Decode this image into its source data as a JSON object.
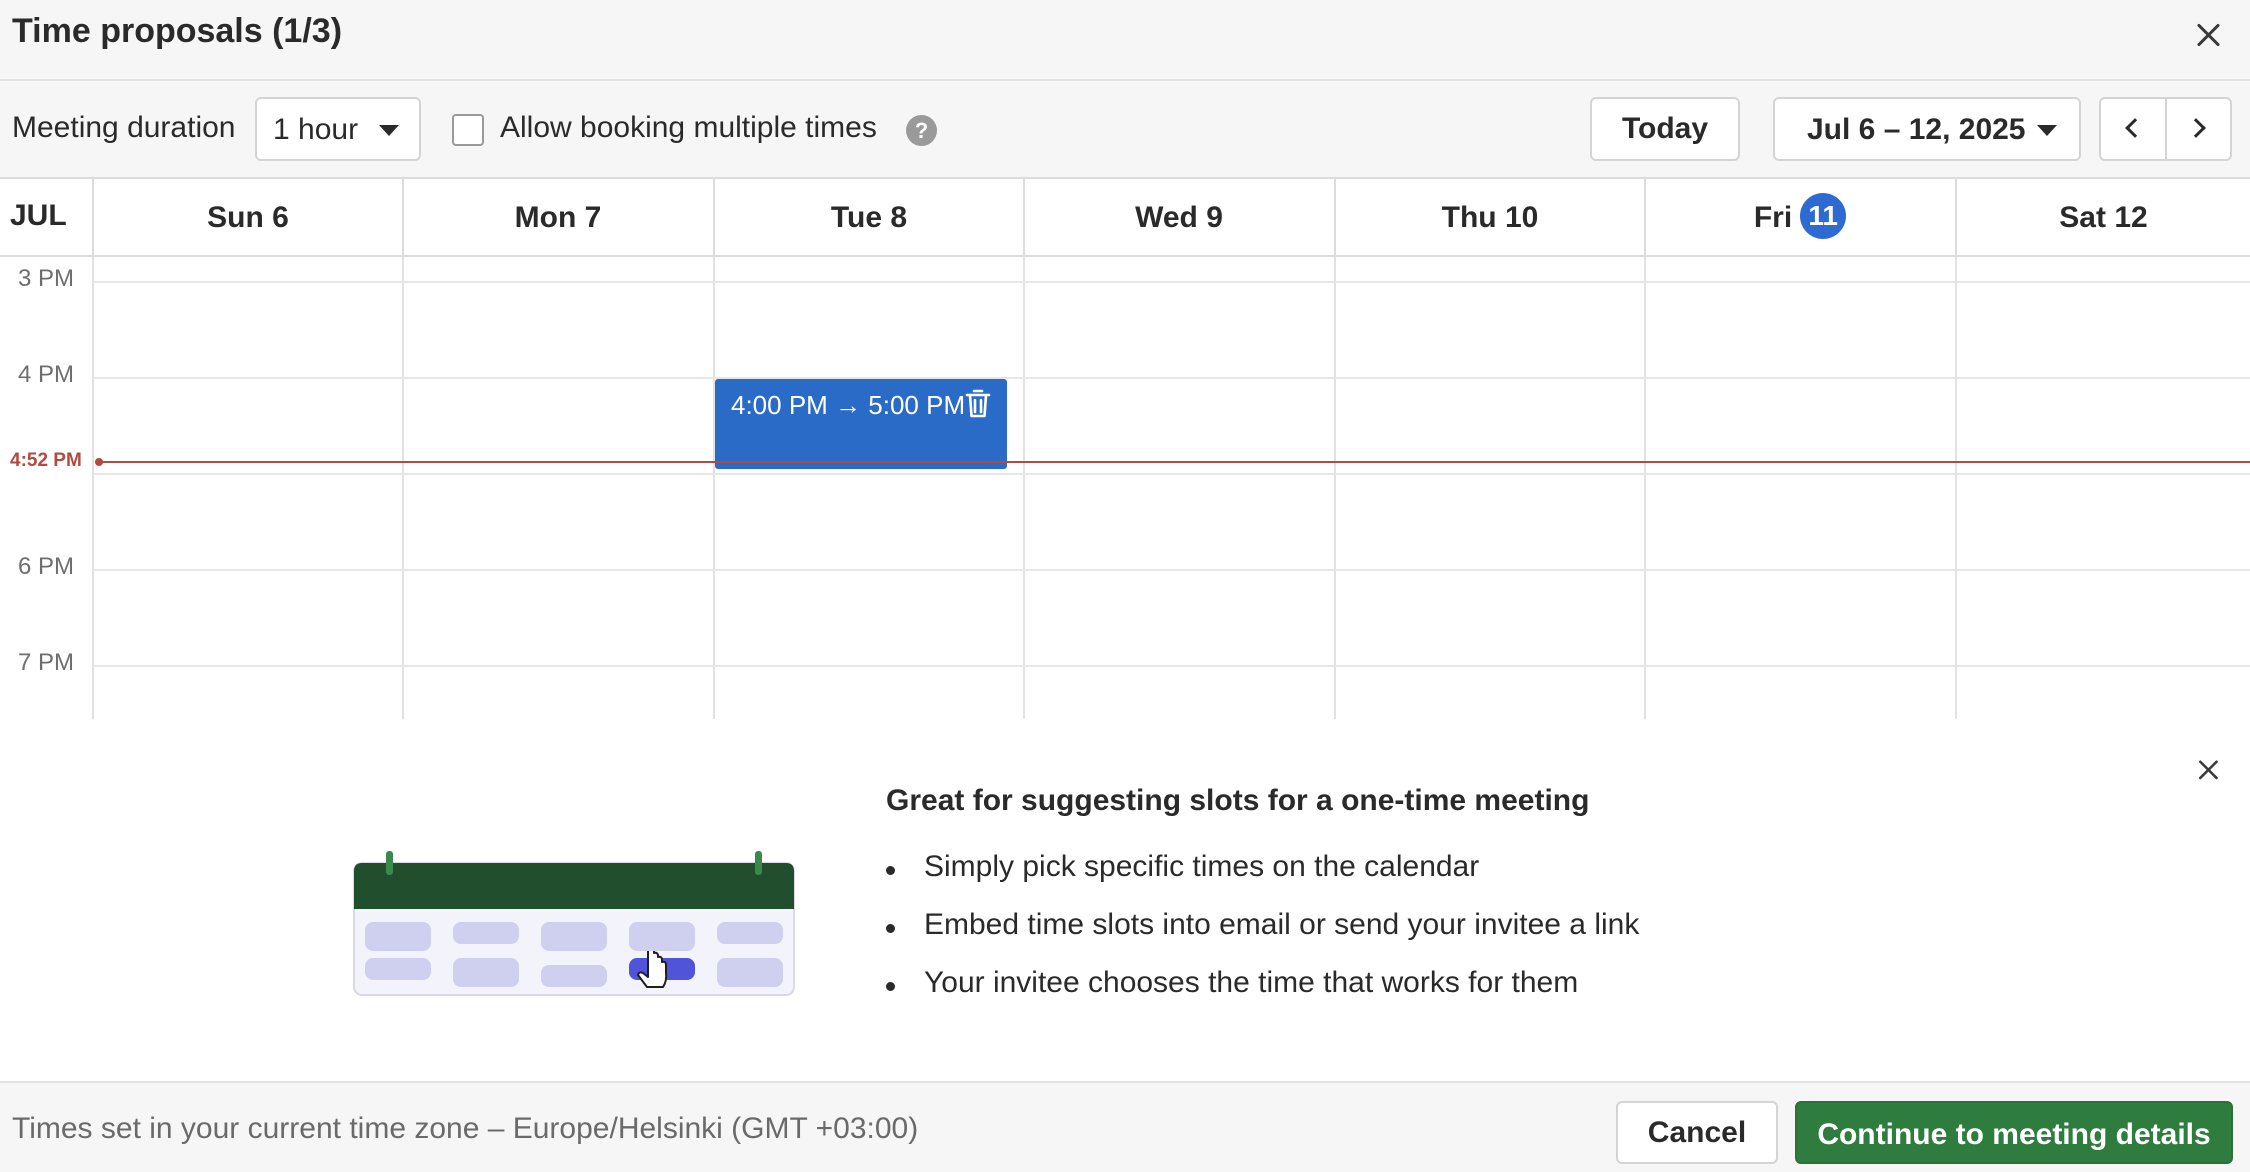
{
  "dialog": {
    "title": "Time proposals (1/3)"
  },
  "toolbar": {
    "duration_label": "Meeting duration",
    "duration_value": "1 hour",
    "multiple_label": "Allow booking multiple times",
    "multiple_checked": false,
    "help_glyph": "?",
    "today_label": "Today",
    "date_range": "Jul 6 – 12, 2025"
  },
  "calendar": {
    "month": "JUL",
    "days": [
      {
        "label": "Sun 6"
      },
      {
        "label": "Mon 7"
      },
      {
        "label": "Tue 8"
      },
      {
        "label": "Wed 9"
      },
      {
        "label": "Thu 10"
      },
      {
        "label": "Fri",
        "badge": "11"
      },
      {
        "label": "Sat 12"
      }
    ],
    "hours": [
      "3 PM",
      "4 PM",
      "6 PM",
      "7 PM"
    ],
    "current_time": "4:52 PM",
    "event": {
      "label": "4:00 PM → 5:00 PM",
      "day": "Tue 8",
      "color": "#2b6bc8"
    }
  },
  "info": {
    "title": "Great for suggesting slots for a one-time meeting",
    "bullets": [
      "Simply pick specific times on the calendar",
      "Embed time slots into email or send your invitee a link",
      "Your invitee chooses the time that works for them"
    ]
  },
  "footer": {
    "timezone": "Times set in your current time zone – Europe/Helsinki (GMT +03:00)",
    "cancel_label": "Cancel",
    "continue_label": "Continue to meeting details"
  },
  "colors": {
    "accent": "#2d6ad1",
    "primary_button": "#2f7d3e",
    "now_line": "#b24a40"
  }
}
